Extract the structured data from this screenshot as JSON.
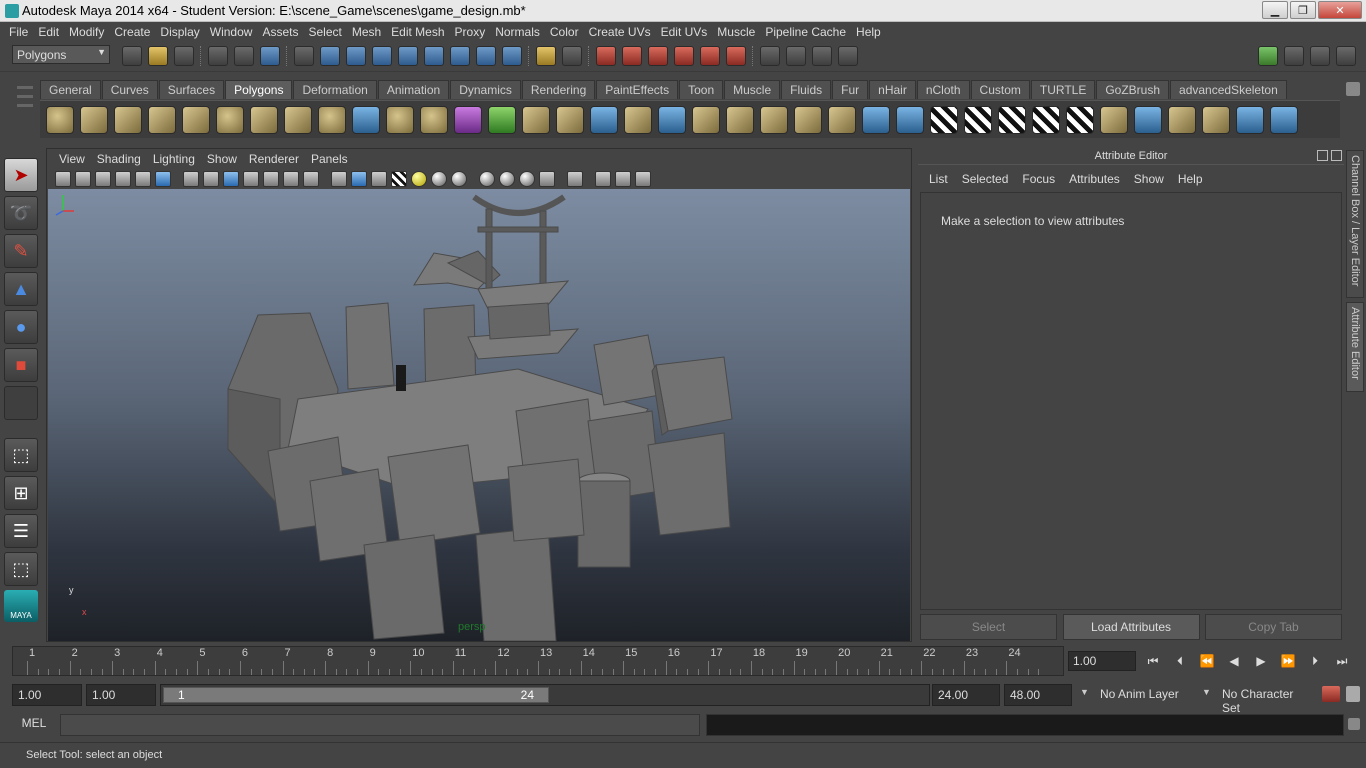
{
  "window": {
    "title": "Autodesk Maya 2014 x64 - Student Version: E:\\scene_Game\\scenes\\game_design.mb*",
    "minimize": "▁",
    "maximize": "❐",
    "close": "✕"
  },
  "menubar": [
    "File",
    "Edit",
    "Modify",
    "Create",
    "Display",
    "Window",
    "Assets",
    "Select",
    "Mesh",
    "Edit Mesh",
    "Proxy",
    "Normals",
    "Color",
    "Create UVs",
    "Edit UVs",
    "Muscle",
    "Pipeline Cache",
    "Help"
  ],
  "statusline": {
    "mode": "Polygons",
    "mode_arrow": "▼"
  },
  "shelf": {
    "tabs": [
      "General",
      "Curves",
      "Surfaces",
      "Polygons",
      "Deformation",
      "Animation",
      "Dynamics",
      "Rendering",
      "PaintEffects",
      "Toon",
      "Muscle",
      "Fluids",
      "Fur",
      "nHair",
      "nCloth",
      "Custom",
      "TURTLE",
      "GoZBrush",
      "advancedSkeleton"
    ],
    "active_tab": "Polygons"
  },
  "toolbox": {
    "logo_text": "MAYA"
  },
  "viewport": {
    "menus": [
      "View",
      "Shading",
      "Lighting",
      "Show",
      "Renderer",
      "Panels"
    ],
    "camera": "persp",
    "axis_x": "x",
    "axis_y": "y"
  },
  "attribute_editor": {
    "title": "Attribute Editor",
    "menus": [
      "List",
      "Selected",
      "Focus",
      "Attributes",
      "Show",
      "Help"
    ],
    "message": "Make a selection to view attributes",
    "buttons": {
      "select": "Select",
      "load": "Load Attributes",
      "copy": "Copy Tab"
    }
  },
  "side_tabs": {
    "channel_box": "Channel Box / Layer Editor",
    "attribute_editor": "Attribute Editor"
  },
  "timeslider": {
    "ticks": [
      "1",
      "2",
      "3",
      "4",
      "5",
      "6",
      "7",
      "8",
      "9",
      "10",
      "11",
      "12",
      "13",
      "14",
      "15",
      "16",
      "17",
      "18",
      "19",
      "20",
      "21",
      "22",
      "23",
      "24"
    ],
    "current_frame": "1.00",
    "playback": [
      "⏮",
      "⏴",
      "⏪",
      "◀",
      "▶",
      "⏩",
      "⏵",
      "⏭"
    ]
  },
  "range": {
    "start": "1.00",
    "playback_start": "1.00",
    "handle_start": "1",
    "handle_end": "24",
    "playback_end": "24.00",
    "end": "48.00",
    "anim_layer": "No Anim Layer",
    "character_set": "No Character Set"
  },
  "cmdline": {
    "label": "MEL"
  },
  "helpline": {
    "text": "Select Tool: select an object"
  },
  "colors": {
    "ui_bg": "#444444",
    "viewport_top": "#7d8ca2",
    "viewport_bottom": "#1e2228",
    "geometry": "#6e6e6e",
    "camera_label": "#1f7a2a"
  }
}
